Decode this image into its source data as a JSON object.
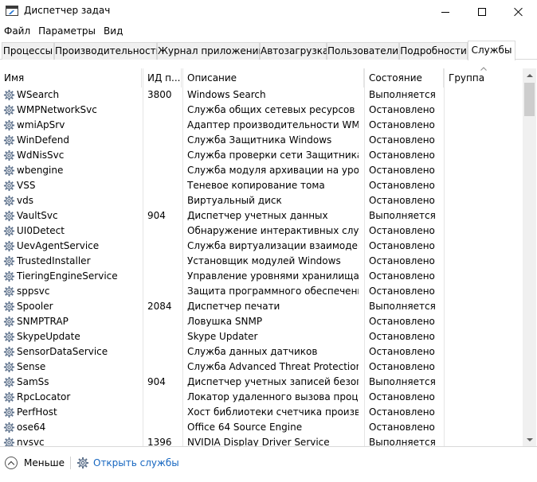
{
  "window": {
    "title": "Диспетчер задач"
  },
  "menu": [
    "Файл",
    "Параметры",
    "Вид"
  ],
  "tabs": [
    "Процессы",
    "Производительность",
    "Журнал приложений",
    "Автозагрузка",
    "Пользователи",
    "Подробности",
    "Службы"
  ],
  "active_tab": "Службы",
  "columns": {
    "name": "Имя",
    "pid": "ИД п...",
    "desc": "Описание",
    "state": "Состояние",
    "group": "Группа"
  },
  "rows": [
    {
      "name": "WSearch",
      "pid": "3800",
      "desc": "Windows Search",
      "state": "Выполняется",
      "group": ""
    },
    {
      "name": "WMPNetworkSvc",
      "pid": "",
      "desc": "Служба общих сетевых ресурсов пр...",
      "state": "Остановлено",
      "group": ""
    },
    {
      "name": "wmiApSrv",
      "pid": "",
      "desc": "Адаптер производительности WMI",
      "state": "Остановлено",
      "group": ""
    },
    {
      "name": "WinDefend",
      "pid": "",
      "desc": "Служба Защитника Windows",
      "state": "Остановлено",
      "group": ""
    },
    {
      "name": "WdNisSvc",
      "pid": "",
      "desc": "Служба проверки сети Защитника W...",
      "state": "Остановлено",
      "group": ""
    },
    {
      "name": "wbengine",
      "pid": "",
      "desc": "Служба модуля архивации на уровн...",
      "state": "Остановлено",
      "group": ""
    },
    {
      "name": "VSS",
      "pid": "",
      "desc": "Теневое копирование тома",
      "state": "Остановлено",
      "group": ""
    },
    {
      "name": "vds",
      "pid": "",
      "desc": "Виртуальный диск",
      "state": "Остановлено",
      "group": ""
    },
    {
      "name": "VaultSvc",
      "pid": "904",
      "desc": "Диспетчер учетных данных",
      "state": "Выполняется",
      "group": ""
    },
    {
      "name": "UI0Detect",
      "pid": "",
      "desc": "Обнаружение интерактивных служб",
      "state": "Остановлено",
      "group": ""
    },
    {
      "name": "UevAgentService",
      "pid": "",
      "desc": "Служба виртуализации взаимодейст...",
      "state": "Остановлено",
      "group": ""
    },
    {
      "name": "TrustedInstaller",
      "pid": "",
      "desc": "Установщик модулей Windows",
      "state": "Остановлено",
      "group": ""
    },
    {
      "name": "TieringEngineService",
      "pid": "",
      "desc": "Управление уровнями хранилища",
      "state": "Остановлено",
      "group": ""
    },
    {
      "name": "sppsvc",
      "pid": "",
      "desc": "Защита программного обеспечения",
      "state": "Остановлено",
      "group": ""
    },
    {
      "name": "Spooler",
      "pid": "2084",
      "desc": "Диспетчер печати",
      "state": "Выполняется",
      "group": ""
    },
    {
      "name": "SNMPTRAP",
      "pid": "",
      "desc": "Ловушка SNMP",
      "state": "Остановлено",
      "group": ""
    },
    {
      "name": "SkypeUpdate",
      "pid": "",
      "desc": "Skype Updater",
      "state": "Остановлено",
      "group": ""
    },
    {
      "name": "SensorDataService",
      "pid": "",
      "desc": "Служба данных датчиков",
      "state": "Остановлено",
      "group": ""
    },
    {
      "name": "Sense",
      "pid": "",
      "desc": "Служба Advanced Threat Protection в...",
      "state": "Остановлено",
      "group": ""
    },
    {
      "name": "SamSs",
      "pid": "904",
      "desc": "Диспетчер учетных записей безопас...",
      "state": "Выполняется",
      "group": ""
    },
    {
      "name": "RpcLocator",
      "pid": "",
      "desc": "Локатор удаленного вызова процеду...",
      "state": "Остановлено",
      "group": ""
    },
    {
      "name": "PerfHost",
      "pid": "",
      "desc": "Хост библиотеки счетчика производ...",
      "state": "Остановлено",
      "group": ""
    },
    {
      "name": "ose64",
      "pid": "",
      "desc": "Office 64 Source Engine",
      "state": "Остановлено",
      "group": ""
    },
    {
      "name": "nvsvc",
      "pid": "1396",
      "desc": "NVIDIA Display Driver Service",
      "state": "Выполняется",
      "group": ""
    }
  ],
  "footer": {
    "less_label": "Меньше",
    "open_services_label": "Открыть службы"
  },
  "colors": {
    "link": "#1666c0",
    "gear": "#5b6f8a"
  }
}
